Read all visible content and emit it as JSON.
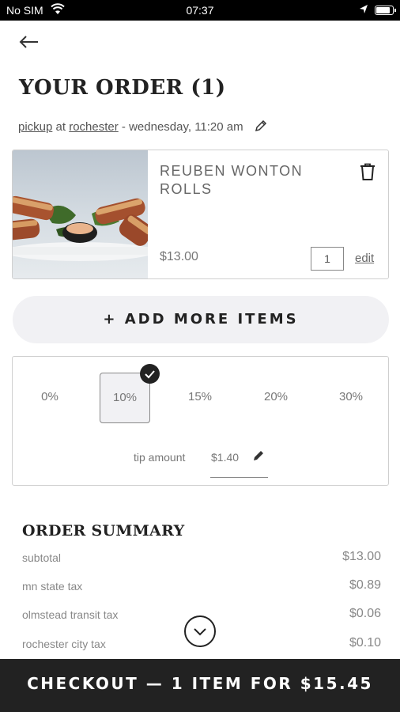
{
  "status_bar": {
    "carrier": "No SIM",
    "time": "07:37",
    "battery_level": 0.9
  },
  "header": {
    "back_icon": "arrow-left-icon",
    "title": "YOUR ORDER (1)"
  },
  "pickup": {
    "method": "pickup",
    "at": "at",
    "location": "rochester",
    "when": "- wednesday, 11:20 am",
    "edit_icon": "pencil-icon"
  },
  "cart_item": {
    "name": "REUBEN WONTON ROLLS",
    "price": "$13.00",
    "quantity": "1",
    "edit_label": "edit",
    "delete_icon": "trash-icon"
  },
  "add_more_label": "+ ADD MORE ITEMS",
  "tip": {
    "options": [
      "0%",
      "10%",
      "15%",
      "20%",
      "30%"
    ],
    "selected": "10%",
    "amount_label": "tip amount",
    "amount_value": "$1.40",
    "edit_icon": "pencil-icon"
  },
  "summary": {
    "title": "ORDER SUMMARY",
    "rows": [
      {
        "label": "subtotal",
        "value": "$13.00"
      },
      {
        "label": "mn state tax",
        "value": "$0.89"
      },
      {
        "label": "olmstead transit tax",
        "value": "$0.06"
      },
      {
        "label": "rochester city tax",
        "value": "$0.10"
      }
    ]
  },
  "scroll_icon": "chevron-down-icon",
  "checkout_label": "CHECKOUT — 1 ITEM FOR $15.45",
  "colors": {
    "primary": "#222222",
    "muted": "#888888",
    "pill_bg": "#f1f1f4"
  }
}
